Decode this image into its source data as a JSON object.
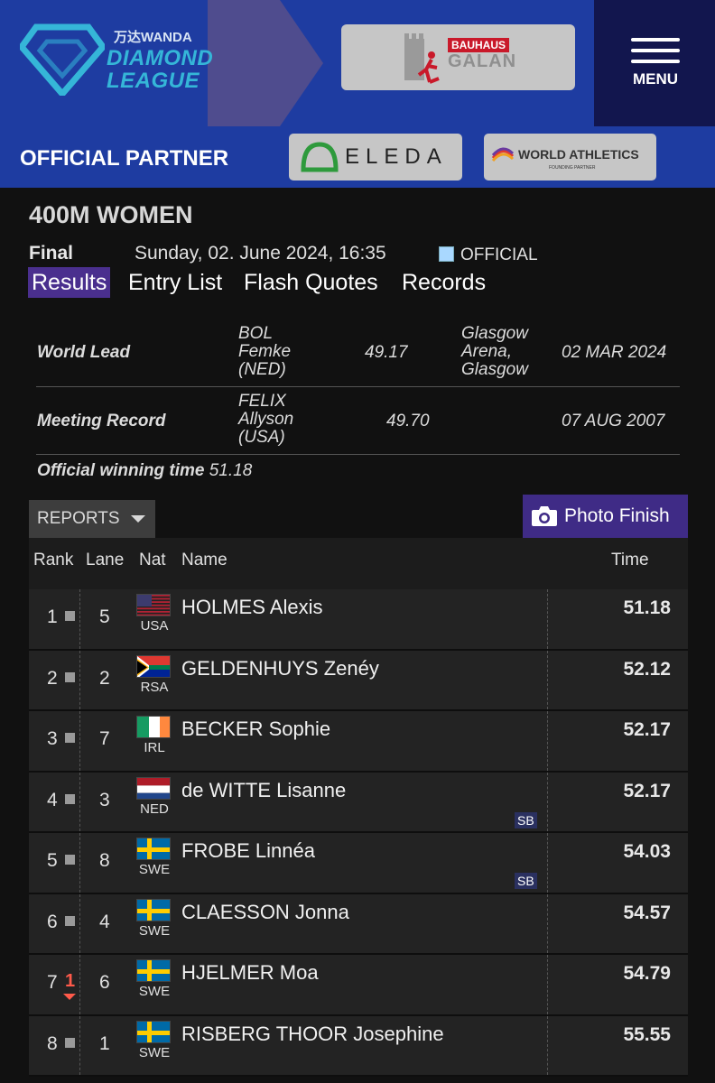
{
  "brand": {
    "wanda": "万达WANDA",
    "league_line1": "DIAMOND",
    "league_line2": "LEAGUE",
    "sponsor_badge": "BAUHAUS",
    "sponsor_name": "GALAN",
    "menu_label": "MENU",
    "partner_label": "OFFICIAL PARTNER",
    "partner1": "ELEDA",
    "partner2": "WORLD ATHLETICS",
    "partner2_sub": "FOUNDING PARTNER"
  },
  "colors": {
    "brand_blue": "#1e3ca1",
    "dark_navy": "#12164e",
    "active_tab": "#4a2f8e",
    "photo_button": "#3f2b86"
  },
  "event": {
    "title": "400M WOMEN",
    "round": "Final",
    "datetime": "Sunday, 02. June 2024, 16:35",
    "status": "OFFICIAL"
  },
  "tabs": [
    "Results",
    "Entry List",
    "Flash Quotes",
    "Records"
  ],
  "records": [
    {
      "label": "World Lead",
      "name": [
        "BOL",
        "Femke",
        "(NED)"
      ],
      "result": "49.17",
      "venue": [
        "Glasgow",
        "Arena,",
        "Glasgow"
      ],
      "date": "02 MAR 2024"
    },
    {
      "label": "Meeting Record",
      "name": [
        "FELIX",
        "Allyson",
        "(USA)"
      ],
      "result": "49.70",
      "venue": [],
      "date": "07 AUG 2007"
    }
  ],
  "official_winning_time": {
    "label": "Official winning time",
    "value": "51.18"
  },
  "reports_label": "REPORTS",
  "photo_finish_label": "Photo Finish",
  "table_headers": {
    "rank": "Rank",
    "lane": "Lane",
    "nat": "Nat",
    "name": "Name",
    "time": "Time"
  },
  "results": [
    {
      "rank": "1",
      "lane": "5",
      "nat": "USA",
      "name": "HOLMES Alexis",
      "time": "51.18",
      "flag": "usa"
    },
    {
      "rank": "2",
      "lane": "2",
      "nat": "RSA",
      "name": "GELDENHUYS Zenéy",
      "time": "52.12",
      "flag": "rsa"
    },
    {
      "rank": "3",
      "lane": "7",
      "nat": "IRL",
      "name": "BECKER Sophie",
      "time": "52.17",
      "flag": "irl"
    },
    {
      "rank": "4",
      "lane": "3",
      "nat": "NED",
      "name": "de WITTE Lisanne",
      "time": "52.17",
      "flag": "ned",
      "badge": "SB"
    },
    {
      "rank": "5",
      "lane": "8",
      "nat": "SWE",
      "name": "FROBE Linnéa",
      "time": "54.03",
      "flag": "swe",
      "badge": "SB"
    },
    {
      "rank": "6",
      "lane": "4",
      "nat": "SWE",
      "name": "CLAESSON Jonna",
      "time": "54.57",
      "flag": "swe"
    },
    {
      "rank": "7",
      "lane": "6",
      "nat": "SWE",
      "name": "HJELMER Moa",
      "time": "54.79",
      "flag": "swe",
      "movement": "1"
    },
    {
      "rank": "8",
      "lane": "1",
      "nat": "SWE",
      "name": "RISBERG THOOR Josephine",
      "time": "55.55",
      "flag": "swe"
    }
  ]
}
